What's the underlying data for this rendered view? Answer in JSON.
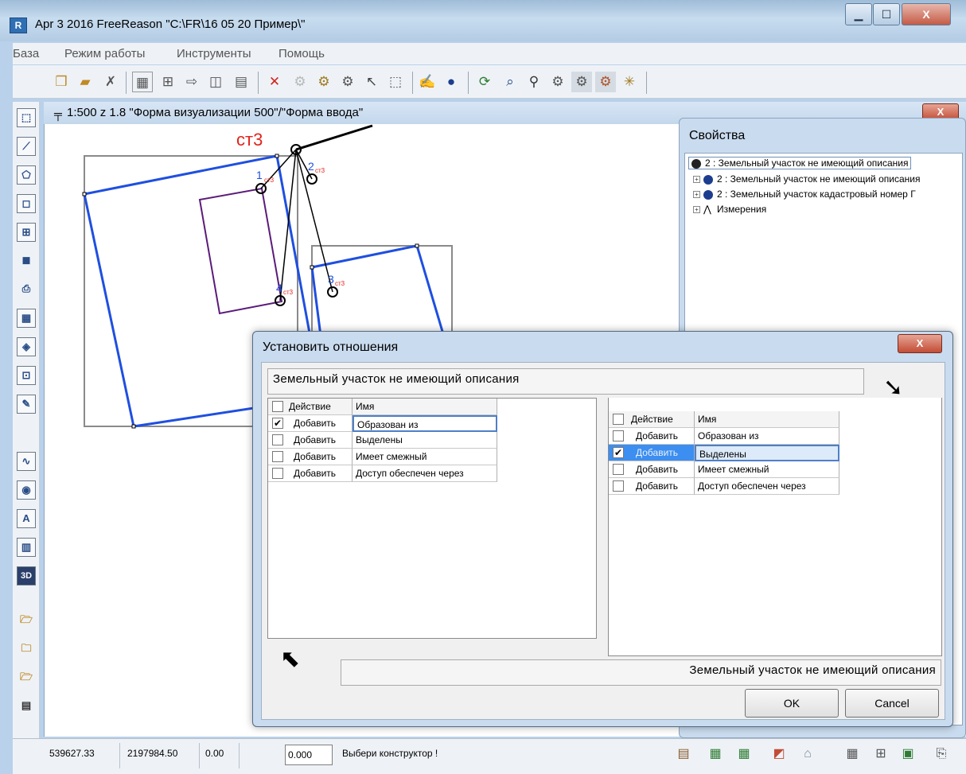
{
  "window": {
    "title": "Apr  3 2016 FreeReason \"C:\\FR\\16 05 20 Пример\\\"",
    "app_icon_text": "R"
  },
  "menu": [
    "База",
    "Режим работы",
    "Инструменты",
    "Помощь"
  ],
  "toolbar_icons": [
    "cube-icon",
    "block-icon",
    "no-line-icon",
    "select-grid-icon",
    "node-icon",
    "link-icon",
    "split-icon",
    "properties-icon",
    "delete-icon",
    "gear-disabled-icon",
    "cubes-icon",
    "cube-move-icon",
    "pointer-icon",
    "select-area-icon",
    "hand-tool-icon",
    "help-icon",
    "refresh-icon",
    "zoom-icon",
    "find-icon",
    "layers-icon",
    "cubes-active-icon",
    "settings-active-icon",
    "star-icon"
  ],
  "left_toolbar_icons": [
    "select-icon",
    "line-icon",
    "polygon-icon",
    "rect-icon",
    "grid-plane-icon",
    "shape-icon",
    "printer-icon",
    "table-icon",
    "target-icon",
    "frame-icon",
    "edit-icon",
    "graph-icon",
    "eye-icon",
    "text-icon",
    "columns-icon",
    "3d-icon",
    "folder-open-icon",
    "folder-warning-icon",
    "folder-arrow-icon",
    "save-list-icon"
  ],
  "child_window": {
    "title": "1:500 z 1.8 \"Форма визуализации 500\"/\"Форма ввода\"",
    "close_label": "X"
  },
  "canvas": {
    "station_label": "ст3",
    "point_labels": [
      "1",
      "2",
      "4",
      "3"
    ],
    "point_sub_label": "ст3"
  },
  "properties": {
    "title": "Свойства",
    "tree": [
      {
        "label": "2 : Земельный участок не имеющий описания",
        "level": 0
      },
      {
        "label": "2 : Земельный участок не имеющий описания",
        "level": 1
      },
      {
        "label": "2 : Земельный участок кадастровый номер Г",
        "level": 1
      },
      {
        "label": "Измерения",
        "level": 1
      }
    ]
  },
  "dialog": {
    "title": "Установить отношения",
    "close_label": "X",
    "top_entity": "Земельный участок не имеющий описания",
    "bottom_entity": "Земельный участок не имеющий описания",
    "headers": {
      "action": "Действие",
      "name": "Имя"
    },
    "left_grid": [
      {
        "action": "Добавить",
        "name": "Образован из",
        "checked": true
      },
      {
        "action": "Добавить",
        "name": "Выделены",
        "checked": false
      },
      {
        "action": "Добавить",
        "name": "Имеет смежный",
        "checked": false
      },
      {
        "action": "Добавить",
        "name": "Доступ обеспечен через",
        "checked": false
      }
    ],
    "right_grid": [
      {
        "action": "Добавить",
        "name": "Образован из",
        "checked": false
      },
      {
        "action": "Добавить",
        "name": "Выделены",
        "checked": true
      },
      {
        "action": "Добавить",
        "name": "Имеет смежный",
        "checked": false
      },
      {
        "action": "Добавить",
        "name": "Доступ обеспечен через",
        "checked": false
      }
    ],
    "ok_label": "OK",
    "cancel_label": "Cancel"
  },
  "status": {
    "x": "539627.33",
    "y": "2197984.50",
    "z": "0.00",
    "input_value": "0.000",
    "message": "Выбери конструктор !"
  }
}
